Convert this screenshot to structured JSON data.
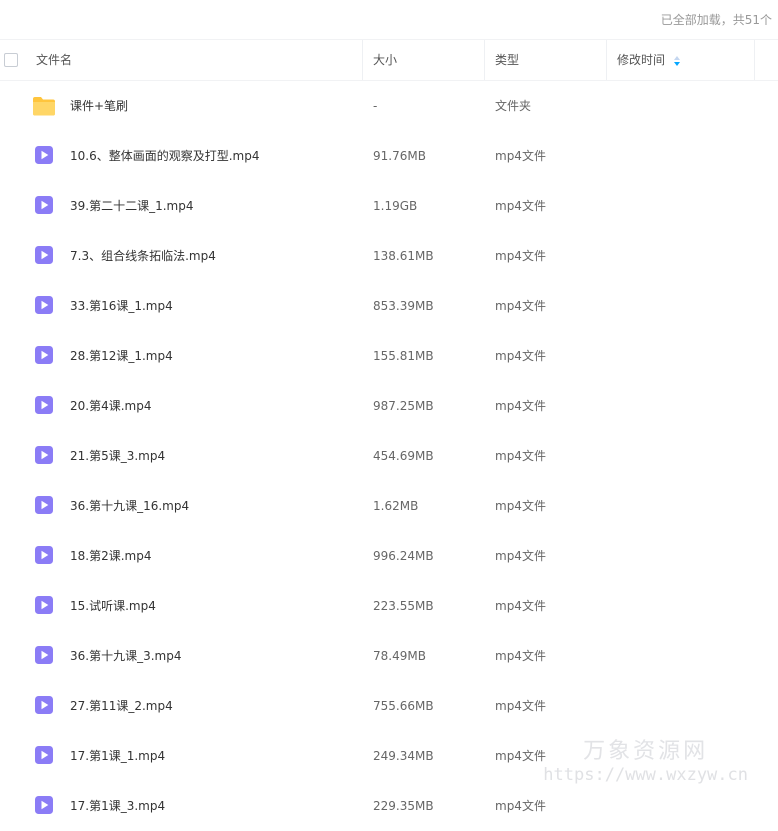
{
  "status": {
    "loaded_text": "已全部加载，共51个"
  },
  "header": {
    "name": "文件名",
    "size": "大小",
    "type": "类型",
    "modified": "修改时间"
  },
  "files": [
    {
      "name": "课件+笔刷",
      "size": "-",
      "type": "文件夹",
      "icon": "folder-icon"
    },
    {
      "name": "10.6、整体画面的观察及打型.mp4",
      "size": "91.76MB",
      "type": "mp4文件",
      "icon": "video-file-icon"
    },
    {
      "name": "39.第二十二课_1.mp4",
      "size": "1.19GB",
      "type": "mp4文件",
      "icon": "video-file-icon"
    },
    {
      "name": "7.3、组合线条拓临法.mp4",
      "size": "138.61MB",
      "type": "mp4文件",
      "icon": "video-file-icon"
    },
    {
      "name": "33.第16课_1.mp4",
      "size": "853.39MB",
      "type": "mp4文件",
      "icon": "video-file-icon"
    },
    {
      "name": "28.第12课_1.mp4",
      "size": "155.81MB",
      "type": "mp4文件",
      "icon": "video-file-icon"
    },
    {
      "name": "20.第4课.mp4",
      "size": "987.25MB",
      "type": "mp4文件",
      "icon": "video-file-icon"
    },
    {
      "name": "21.第5课_3.mp4",
      "size": "454.69MB",
      "type": "mp4文件",
      "icon": "video-file-icon"
    },
    {
      "name": "36.第十九课_16.mp4",
      "size": "1.62MB",
      "type": "mp4文件",
      "icon": "video-file-icon"
    },
    {
      "name": "18.第2课.mp4",
      "size": "996.24MB",
      "type": "mp4文件",
      "icon": "video-file-icon"
    },
    {
      "name": "15.试听课.mp4",
      "size": "223.55MB",
      "type": "mp4文件",
      "icon": "video-file-icon"
    },
    {
      "name": "36.第十九课_3.mp4",
      "size": "78.49MB",
      "type": "mp4文件",
      "icon": "video-file-icon"
    },
    {
      "name": "27.第11课_2.mp4",
      "size": "755.66MB",
      "type": "mp4文件",
      "icon": "video-file-icon"
    },
    {
      "name": "17.第1课_1.mp4",
      "size": "249.34MB",
      "type": "mp4文件",
      "icon": "video-file-icon"
    },
    {
      "name": "17.第1课_3.mp4",
      "size": "229.35MB",
      "type": "mp4文件",
      "icon": "video-file-icon"
    }
  ],
  "watermark": {
    "line1": "万象资源网",
    "line2": "https://www.wxzyw.cn"
  },
  "colors": {
    "folder": "#ffc53d",
    "video": "#8b7cf6",
    "accent": "#06a7ff"
  }
}
